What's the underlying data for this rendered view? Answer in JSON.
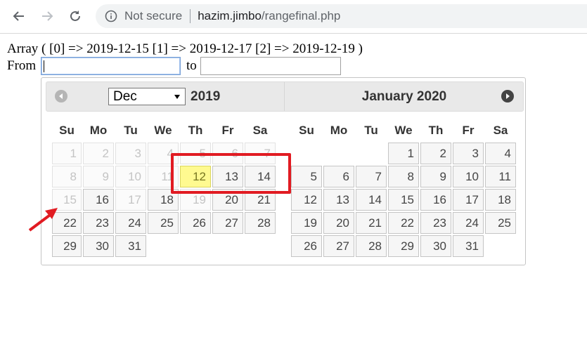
{
  "browser": {
    "security_label": "Not secure",
    "url_host": "hazim.jimbo",
    "url_path": "/rangefinal.php"
  },
  "page": {
    "array_text": "Array ( [0] => 2019-12-15 [1] => 2019-12-17 [2] => 2019-12-19 )",
    "from_label": "From",
    "to_label": "to",
    "from_value": "",
    "to_value": ""
  },
  "datepicker": {
    "month_select_value": "Dec",
    "left_year": "2019",
    "right_title": "January 2020",
    "weekdays": [
      "Su",
      "Mo",
      "Tu",
      "We",
      "Th",
      "Fr",
      "Sa"
    ],
    "left_weeks": [
      [
        {
          "d": "1",
          "s": "disabled"
        },
        {
          "d": "2",
          "s": "disabled"
        },
        {
          "d": "3",
          "s": "disabled"
        },
        {
          "d": "4",
          "s": "disabled"
        },
        {
          "d": "5",
          "s": "disabled"
        },
        {
          "d": "6",
          "s": "disabled"
        },
        {
          "d": "7",
          "s": "disabled"
        }
      ],
      [
        {
          "d": "8",
          "s": "disabled"
        },
        {
          "d": "9",
          "s": "disabled"
        },
        {
          "d": "10",
          "s": "disabled"
        },
        {
          "d": "11",
          "s": "disabled"
        },
        {
          "d": "12",
          "s": "highlight"
        },
        {
          "d": "13",
          "s": "normal"
        },
        {
          "d": "14",
          "s": "normal"
        }
      ],
      [
        {
          "d": "15",
          "s": "disabled"
        },
        {
          "d": "16",
          "s": "normal"
        },
        {
          "d": "17",
          "s": "disabled"
        },
        {
          "d": "18",
          "s": "normal"
        },
        {
          "d": "19",
          "s": "disabled"
        },
        {
          "d": "20",
          "s": "normal"
        },
        {
          "d": "21",
          "s": "normal"
        }
      ],
      [
        {
          "d": "22",
          "s": "normal"
        },
        {
          "d": "23",
          "s": "normal"
        },
        {
          "d": "24",
          "s": "normal"
        },
        {
          "d": "25",
          "s": "normal"
        },
        {
          "d": "26",
          "s": "normal"
        },
        {
          "d": "27",
          "s": "normal"
        },
        {
          "d": "28",
          "s": "normal"
        }
      ],
      [
        {
          "d": "29",
          "s": "normal"
        },
        {
          "d": "30",
          "s": "normal"
        },
        {
          "d": "31",
          "s": "normal"
        },
        null,
        null,
        null,
        null
      ]
    ],
    "right_weeks": [
      [
        null,
        null,
        null,
        {
          "d": "1",
          "s": "normal"
        },
        {
          "d": "2",
          "s": "normal"
        },
        {
          "d": "3",
          "s": "normal"
        },
        {
          "d": "4",
          "s": "normal"
        }
      ],
      [
        {
          "d": "5",
          "s": "normal"
        },
        {
          "d": "6",
          "s": "normal"
        },
        {
          "d": "7",
          "s": "normal"
        },
        {
          "d": "8",
          "s": "normal"
        },
        {
          "d": "9",
          "s": "normal"
        },
        {
          "d": "10",
          "s": "normal"
        },
        {
          "d": "11",
          "s": "normal"
        }
      ],
      [
        {
          "d": "12",
          "s": "normal"
        },
        {
          "d": "13",
          "s": "normal"
        },
        {
          "d": "14",
          "s": "normal"
        },
        {
          "d": "15",
          "s": "normal"
        },
        {
          "d": "16",
          "s": "normal"
        },
        {
          "d": "17",
          "s": "normal"
        },
        {
          "d": "18",
          "s": "normal"
        }
      ],
      [
        {
          "d": "19",
          "s": "normal"
        },
        {
          "d": "20",
          "s": "normal"
        },
        {
          "d": "21",
          "s": "normal"
        },
        {
          "d": "22",
          "s": "normal"
        },
        {
          "d": "23",
          "s": "normal"
        },
        {
          "d": "24",
          "s": "normal"
        },
        {
          "d": "25",
          "s": "normal"
        }
      ],
      [
        {
          "d": "26",
          "s": "normal"
        },
        {
          "d": "27",
          "s": "normal"
        },
        {
          "d": "28",
          "s": "normal"
        },
        {
          "d": "29",
          "s": "normal"
        },
        {
          "d": "30",
          "s": "normal"
        },
        {
          "d": "31",
          "s": "normal"
        },
        null
      ]
    ]
  },
  "annotations": {
    "color": "#e11b22"
  }
}
